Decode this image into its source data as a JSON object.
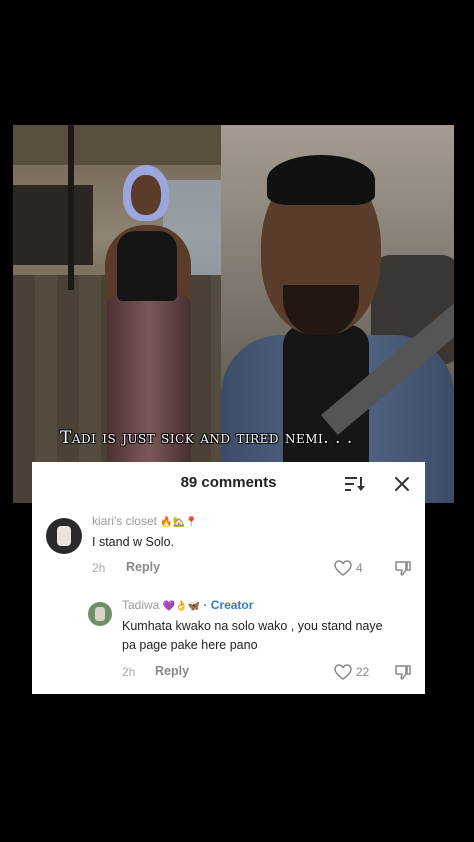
{
  "caption": "Tadi is just sick and tired nemi. . .",
  "comments_panel": {
    "title": "89 comments",
    "icons": {
      "sort": "sort-icon",
      "close": "close-icon"
    }
  },
  "comments": [
    {
      "username": "kiari's closet",
      "emojis": "🔥🏡📍",
      "text": "I stand w Solo.",
      "time": "2h",
      "reply_label": "Reply",
      "likes": "4"
    },
    {
      "username": "Tadiwa",
      "emojis": "💜👌🦋",
      "creator_label": "· Creator",
      "text_line1": "Kumhata kwako na solo wako , you stand naye",
      "text_line2": "pa page pake here pano",
      "time": "2h",
      "reply_label": "Reply",
      "likes": "22"
    }
  ],
  "colors": {
    "background": "#000000",
    "creator": "#2d7fd0"
  }
}
